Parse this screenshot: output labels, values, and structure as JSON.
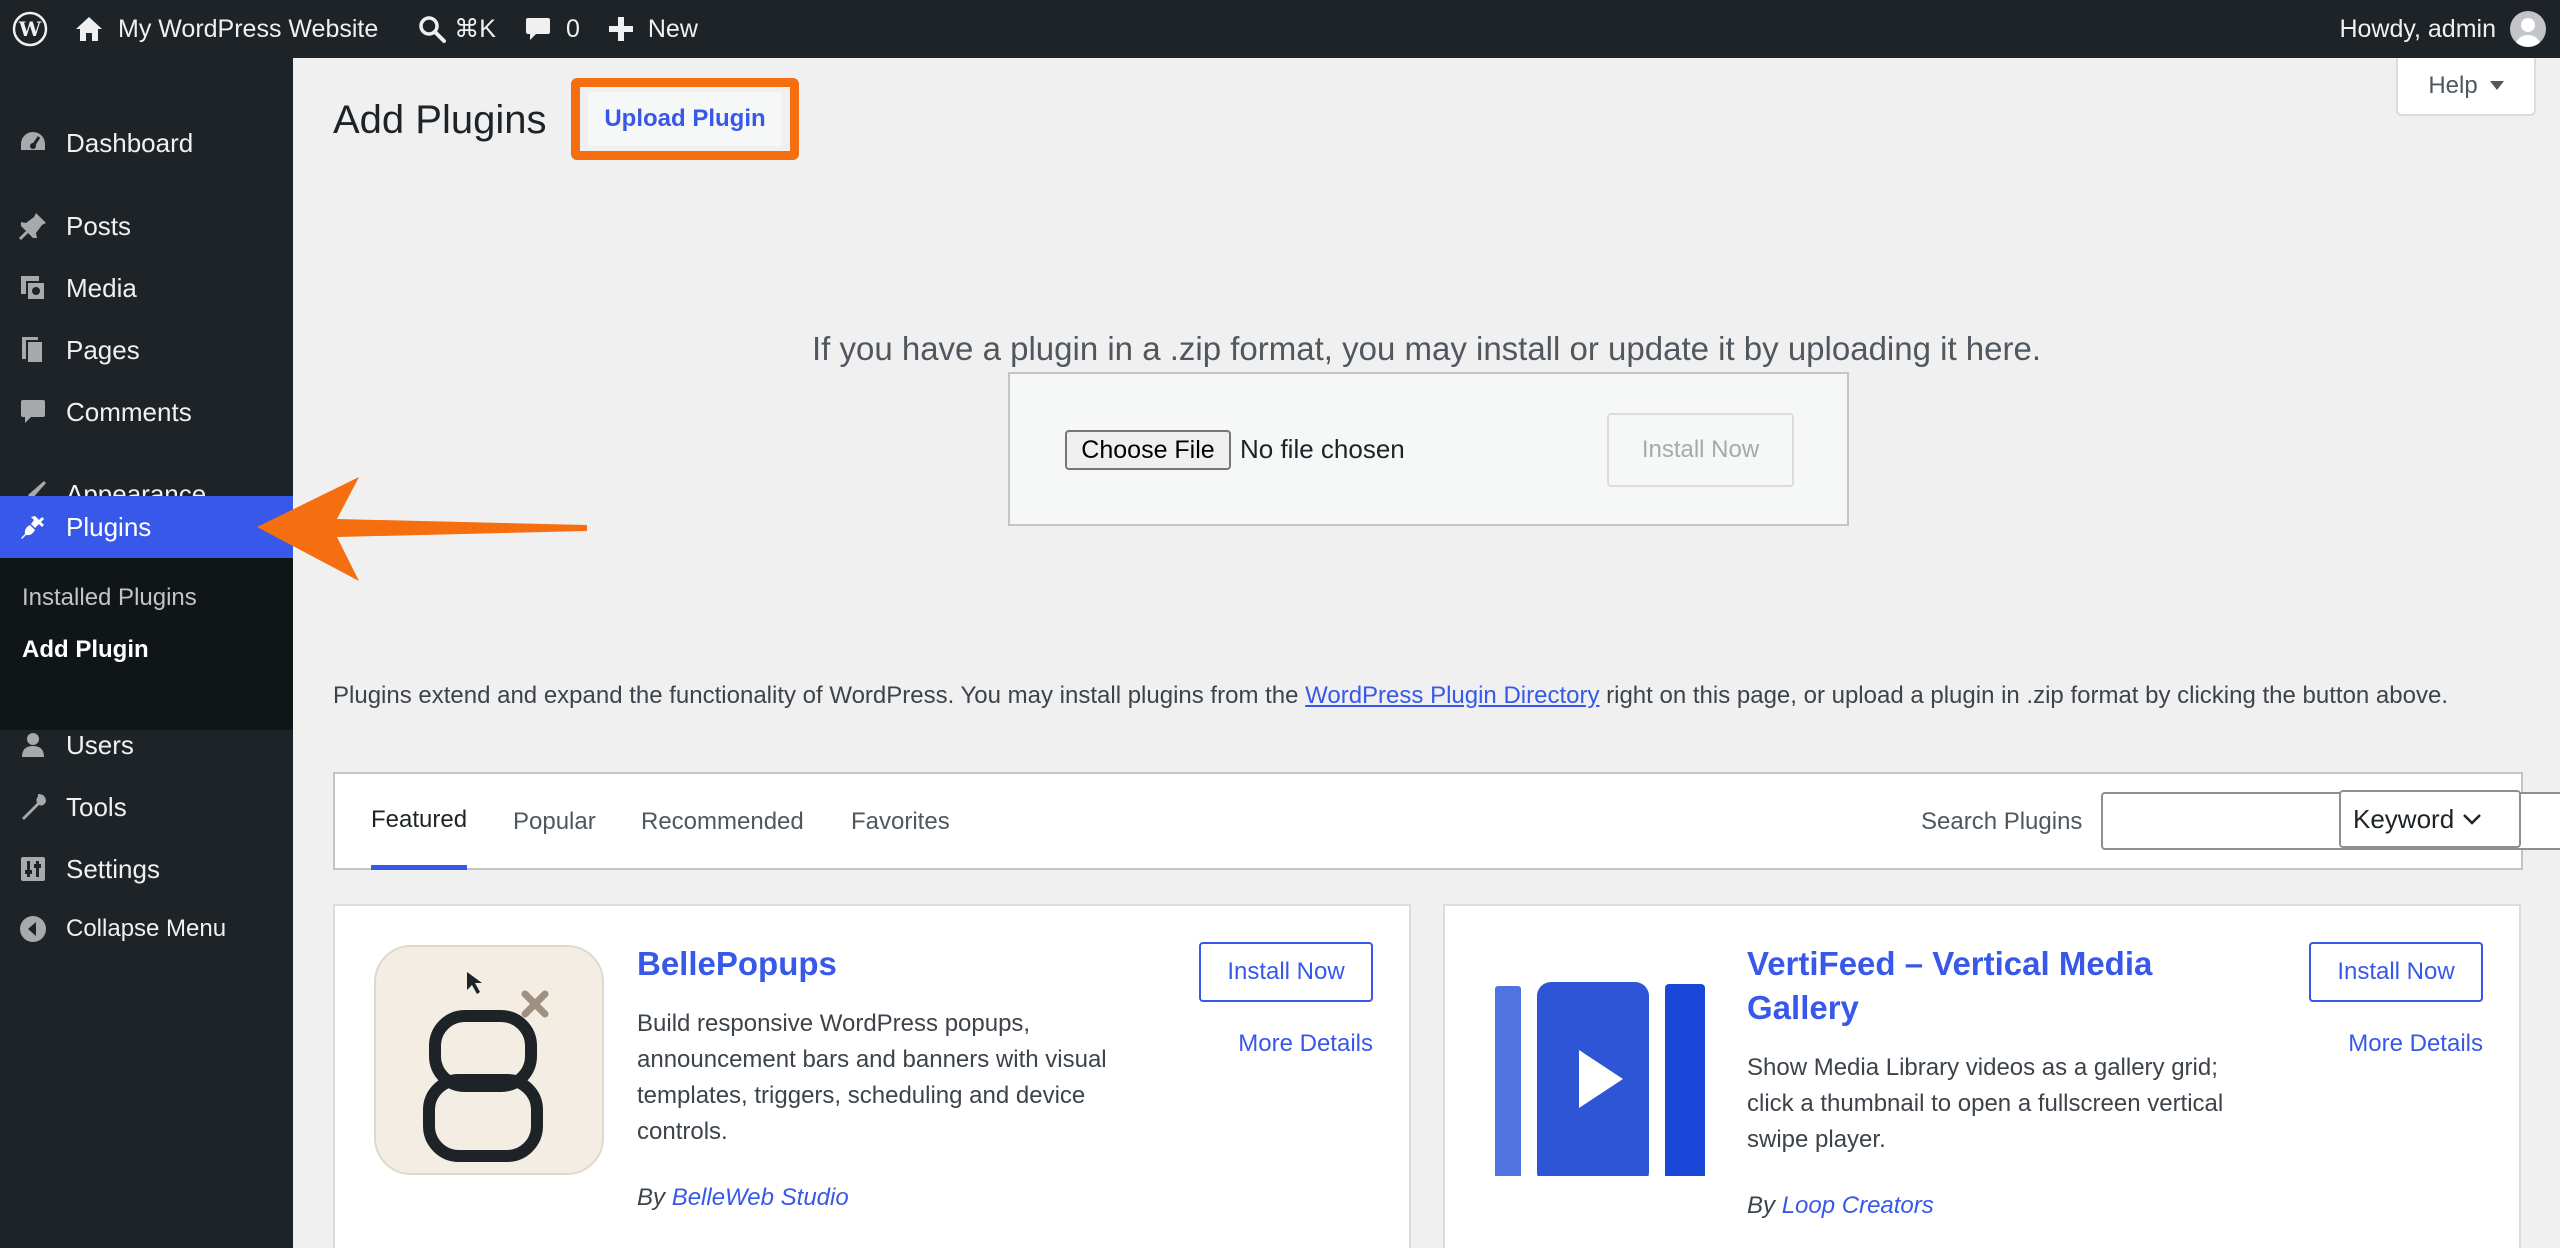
{
  "adminbar": {
    "site_name": "My WordPress Website",
    "search_shortcut": "⌘K",
    "comments_count": "0",
    "new_label": "New",
    "howdy": "Howdy, admin"
  },
  "sidebar": {
    "items": [
      {
        "label": "Dashboard",
        "icon": "dashboard-icon"
      },
      {
        "label": "Posts",
        "icon": "pin-icon"
      },
      {
        "label": "Media",
        "icon": "media-icon"
      },
      {
        "label": "Pages",
        "icon": "pages-icon"
      },
      {
        "label": "Comments",
        "icon": "comment-icon"
      },
      {
        "label": "Appearance",
        "icon": "brush-icon"
      },
      {
        "label": "Plugins",
        "icon": "plugin-icon"
      },
      {
        "label": "Users",
        "icon": "users-icon"
      },
      {
        "label": "Tools",
        "icon": "wrench-icon"
      },
      {
        "label": "Settings",
        "icon": "settings-icon"
      },
      {
        "label": "Collapse Menu",
        "icon": "collapse-icon"
      }
    ],
    "submenu": [
      {
        "label": "Installed Plugins"
      },
      {
        "label": "Add Plugin"
      }
    ]
  },
  "main": {
    "title": "Add Plugins",
    "upload_button": "Upload Plugin",
    "help_label": "Help",
    "upload_description": "If you have a plugin in a .zip format, you may install or update it by uploading it here.",
    "choose_file": "Choose File",
    "no_file": "No file chosen",
    "install_now": "Install Now",
    "intro_before": "Plugins extend and expand the functionality of WordPress. You may install plugins from the ",
    "intro_link": "WordPress Plugin Directory",
    "intro_after": " right on this page, or upload a plugin in .zip format by clicking the button above.",
    "tabs": [
      {
        "label": "Featured"
      },
      {
        "label": "Popular"
      },
      {
        "label": "Recommended"
      },
      {
        "label": "Favorites"
      }
    ],
    "search_label": "Search Plugins",
    "search_value": "",
    "search_type": "Keyword"
  },
  "plugins": [
    {
      "name": "BellePopups",
      "description": "Build responsive WordPress popups, announcement bars and banners with visual templates, triggers, scheduling and device controls.",
      "by": "By",
      "author": "BelleWeb Studio",
      "install": "Install Now",
      "details": "More Details"
    },
    {
      "name": "VertiFeed – Vertical Media Gallery",
      "description": "Show Media Library videos as a gallery grid; click a thumbnail to open a fullscreen vertical swipe player.",
      "by": "By",
      "author": "Loop Creators",
      "install": "Install Now",
      "details": "More Details"
    }
  ],
  "colors": {
    "accent": "#3858e9",
    "highlight": "#f56e0f",
    "adminbar_bg": "#1d2327"
  }
}
